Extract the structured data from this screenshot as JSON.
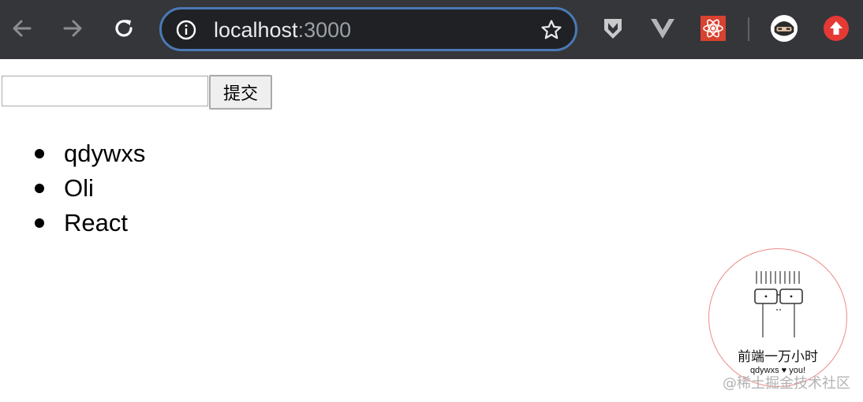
{
  "browser": {
    "url_host": "localhost",
    "url_port": ":3000",
    "icons": {
      "back": "back-arrow-icon",
      "forward": "forward-arrow-icon",
      "reload": "reload-icon",
      "info": "info-icon",
      "star": "bookmark-star-icon",
      "ext1": "shield-extension-icon",
      "ext2": "vue-devtools-icon",
      "ext3": "react-devtools-icon",
      "profile": "profile-avatar-icon",
      "update": "update-icon"
    },
    "colors": {
      "toolbar": "#35363a",
      "omnibox_border": "#4a79b5",
      "update": "#e53935"
    }
  },
  "form": {
    "input_value": "",
    "input_placeholder": "",
    "submit_label": "提交"
  },
  "list": {
    "items": [
      "qdywxs",
      "Oli",
      "React"
    ]
  },
  "badge": {
    "title": "前端一万小时",
    "subtitle": "qdywxs ♥ you!"
  },
  "watermark": "@稀土掘金技术社区"
}
